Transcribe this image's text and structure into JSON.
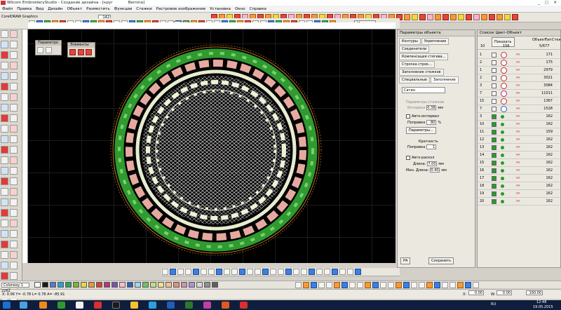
{
  "window": {
    "title": "Wilcom EmbroideryStudio - Создание дизайна - [круг",
    "title_suffix": "Bernina]"
  },
  "menu": [
    "Файл",
    "Правка",
    "Вид",
    "Дизайн",
    "Объект",
    "Разместить",
    "Функции",
    "Стежки",
    "Растровое изображение",
    "Установка",
    "Окно",
    "Справка"
  ],
  "toolbar": {
    "corel_label": "CorelDRAW Graphics",
    "size_value": "142",
    "size_value_2": "142",
    "metric_label": "Метрика"
  },
  "floating_panels": {
    "params_title": "Параметро",
    "elements_title": "Элементы"
  },
  "object_properties": {
    "title": "Параметры объекта",
    "tabs": [
      "Контуры",
      "Укрепление",
      "Соединители",
      "Компенсация стягива...",
      "Строчка строк...",
      "Заполнение стежков",
      "Специальные",
      "Заполнение"
    ],
    "stitch_type": "Сатин",
    "params_label": "Параметры стежков",
    "interval_label": "Интервал",
    "interval_value": "0.38",
    "interval_unit": "мм",
    "auto_interval_label": "Авто-интервал",
    "correction_label": "Поправка",
    "correction_value": "80",
    "correction_unit": "%",
    "params_button": "Параметры...",
    "multiplicity_label": "Кратность",
    "multiplicity_correction_label": "Поправка",
    "multiplicity_value": "1",
    "auto_split_label": "Авто-раскол",
    "length_label": "Длина:",
    "length_value": "7.00",
    "length_unit": "мм",
    "min_length_label": "Мин. Длина:",
    "min_length_value": "0.40",
    "min_length_unit": "мм",
    "save_button": "Сохранить",
    "footer_left": "РА"
  },
  "color_list": {
    "title": "Список Цвет-Объект",
    "show_button": "Показать",
    "col_obj": "Объект",
    "col_type": "Тип",
    "col_stitches": "Стежки",
    "header_count": "10",
    "header_total": "156",
    "header_stitches": "5/677",
    "rows": [
      {
        "idx": "1",
        "stitches": "171"
      },
      {
        "idx": "2",
        "stitches": "175"
      },
      {
        "idx": "1",
        "stitches": "2979"
      },
      {
        "idx": "2",
        "stitches": "3021"
      },
      {
        "idx": "3",
        "stitches": "3084"
      },
      {
        "idx": "7",
        "stitches": "11011"
      },
      {
        "idx": "15",
        "stitches": "1367"
      },
      {
        "idx": "7",
        "stitches": "1528"
      },
      {
        "idx": "3",
        "stitches": "162"
      },
      {
        "idx": "10",
        "stitches": "162"
      },
      {
        "idx": "11",
        "stitches": "159"
      },
      {
        "idx": "12",
        "stitches": "162"
      },
      {
        "idx": "13",
        "stitches": "162"
      },
      {
        "idx": "14",
        "stitches": "162"
      },
      {
        "idx": "15",
        "stitches": "162"
      },
      {
        "idx": "16",
        "stitches": "162"
      },
      {
        "idx": "17",
        "stitches": "162"
      },
      {
        "idx": "18",
        "stitches": "162"
      },
      {
        "idx": "19",
        "stitches": "162"
      },
      {
        "idx": "20",
        "stitches": "162"
      }
    ]
  },
  "palette": {
    "name": "Colorway 1",
    "colors": [
      "#ffffff",
      "#1a1a1a",
      "#5a78c8",
      "#2aa2d8",
      "#30a060",
      "#7ab630",
      "#e8d640",
      "#e89a30",
      "#d84030",
      "#c03080",
      "#8050b0",
      "#f2c0d0",
      "#3060b0",
      "#a0d8f0",
      "#70c070",
      "#c0e080",
      "#f0e090",
      "#f0c090",
      "#e09080",
      "#d090b0",
      "#b090d0",
      "#d8d8d8",
      "#909090",
      "#606060"
    ]
  },
  "status": {
    "left": "X: 0.06 Y= -0.78 L= 0.78 A= -85.91",
    "zoom": "100.00",
    "x_label": "X:",
    "x_value": "0.00",
    "y_label": "Y:",
    "y_value": "0.00",
    "w_label": "W:",
    "w_value": "0.00",
    "h_label": "H:",
    "h_value": "0.00",
    "pct1": "100.00",
    "pct2": "100.00",
    "left_top": "2262"
  },
  "taskbar": {
    "time": "12:48",
    "date": "19.05.2015",
    "lang": "RU"
  }
}
